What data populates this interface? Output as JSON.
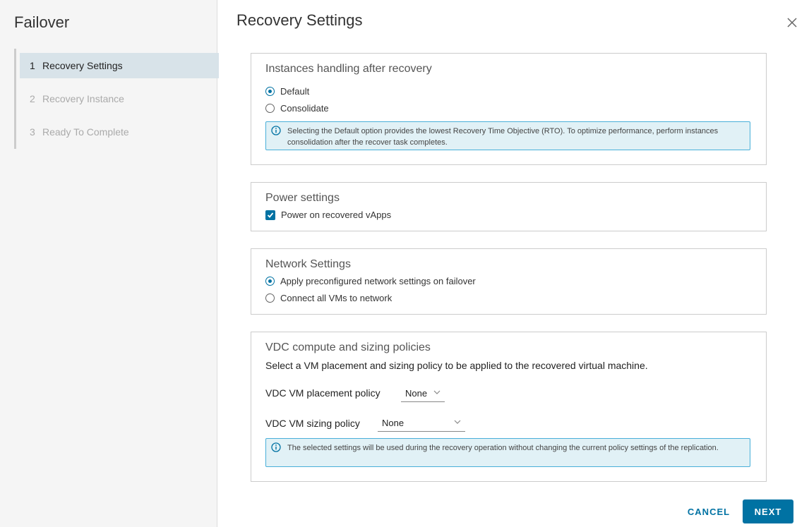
{
  "wizard": {
    "title": "Failover",
    "steps": [
      {
        "num": "1",
        "label": "Recovery Settings"
      },
      {
        "num": "2",
        "label": "Recovery Instance"
      },
      {
        "num": "3",
        "label": "Ready To Complete"
      }
    ]
  },
  "page": {
    "title": "Recovery Settings"
  },
  "instances": {
    "title": "Instances handling after recovery",
    "options": [
      {
        "label": "Default",
        "checked": true
      },
      {
        "label": "Consolidate",
        "checked": false
      }
    ],
    "info": "Selecting the Default option provides the lowest Recovery Time Objective (RTO). To optimize performance, perform instances consolidation after the recover task completes."
  },
  "power": {
    "title": "Power settings",
    "checkbox_label": "Power on recovered vApps",
    "checked": true
  },
  "network": {
    "title": "Network Settings",
    "options": [
      {
        "label": "Apply preconfigured network settings on failover",
        "checked": true
      },
      {
        "label": "Connect all VMs to network",
        "checked": false
      }
    ]
  },
  "vdc": {
    "title": "VDC compute and sizing policies",
    "description": "Select a VM placement and sizing policy to be applied to the recovered virtual machine.",
    "placement_label": "VDC VM placement policy",
    "placement_value": "None",
    "sizing_label": "VDC VM sizing policy",
    "sizing_value": "None",
    "info": "The selected settings will be used during the recovery operation without changing the current policy settings of the replication."
  },
  "footer": {
    "cancel": "CANCEL",
    "next": "NEXT"
  },
  "colors": {
    "accent": "#0072a3",
    "info_border": "#49afd9",
    "info_bg": "#e1f1f6"
  }
}
